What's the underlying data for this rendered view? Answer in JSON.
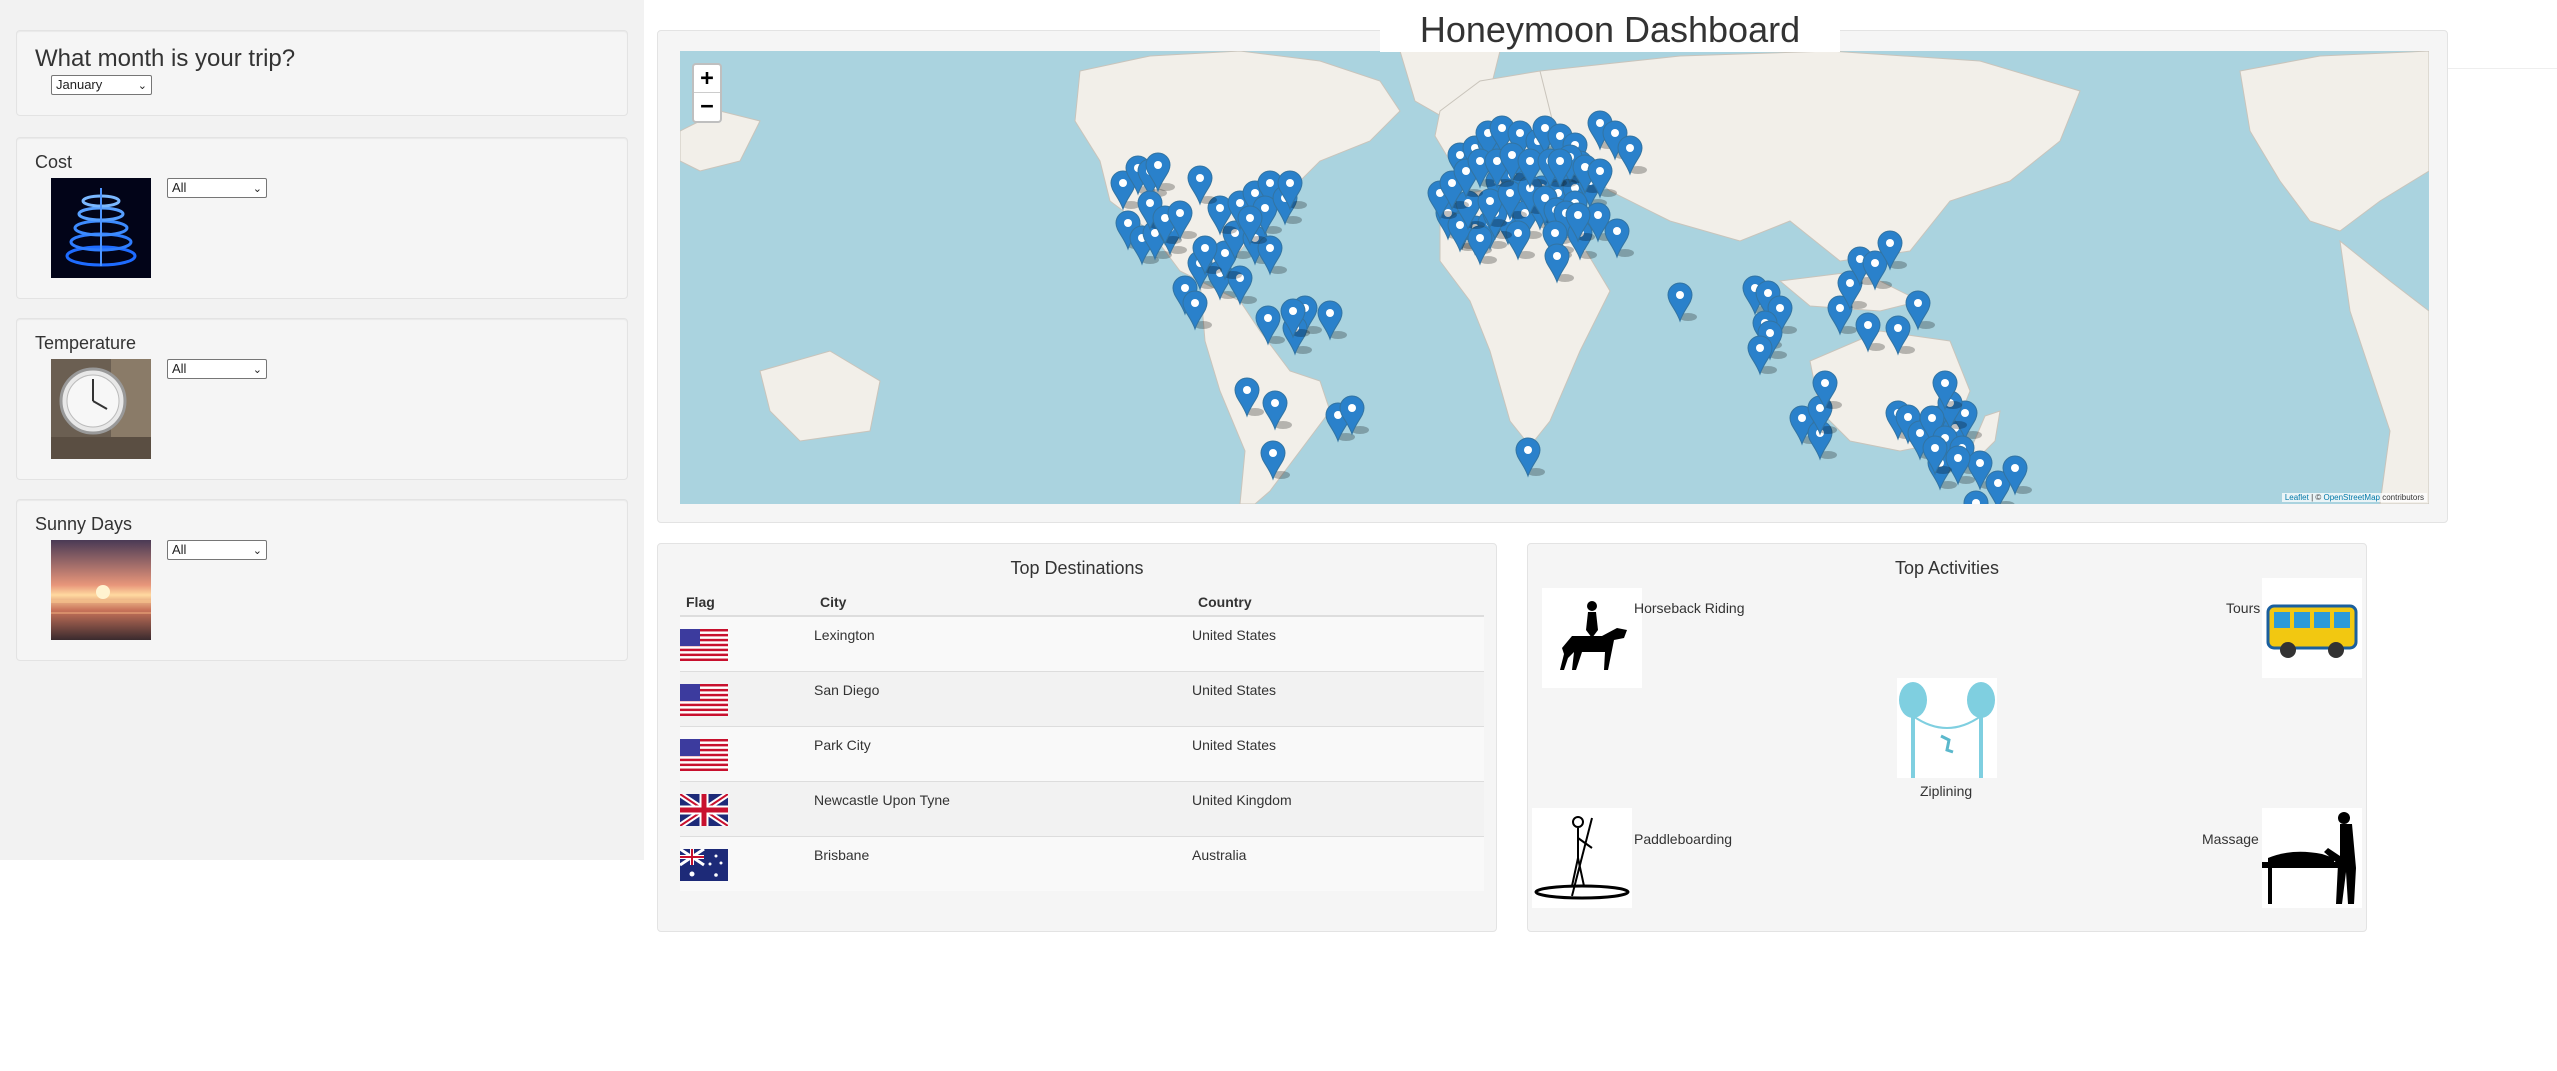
{
  "header": {
    "title": "Honeymoon Dashboard"
  },
  "sidebar": {
    "month": {
      "label": "What month is your trip?",
      "selected": "January"
    },
    "cost": {
      "label": "Cost",
      "selected": "All",
      "image": "cost-image"
    },
    "temperature": {
      "label": "Temperature",
      "selected": "All",
      "image": "thermometer-image"
    },
    "sunny": {
      "label": "Sunny Days",
      "selected": "All",
      "image": "sunset-image"
    }
  },
  "map": {
    "zoom_in": "+",
    "zoom_out": "−",
    "attribution_leaflet": "Leaflet",
    "attribution_sep": " | © ",
    "attribution_osm": "OpenStreetMap",
    "attribution_tail": " contributors",
    "marker_color": "#2a81cb"
  },
  "destinations": {
    "title": "Top Destinations",
    "columns": [
      "Flag",
      "City",
      "Country"
    ],
    "rows": [
      {
        "flag": "us-flag",
        "city": "Lexington",
        "country": "United States"
      },
      {
        "flag": "us-flag",
        "city": "San Diego",
        "country": "United States"
      },
      {
        "flag": "us-flag",
        "city": "Park City",
        "country": "United States"
      },
      {
        "flag": "uk-flag",
        "city": "Newcastle Upon Tyne",
        "country": "United Kingdom"
      },
      {
        "flag": "au-flag",
        "city": "Brisbane",
        "country": "Australia"
      }
    ]
  },
  "activities": {
    "title": "Top Activities",
    "items": [
      {
        "label": "Horseback Riding",
        "icon": "horse-rider-icon"
      },
      {
        "label": "Tours",
        "icon": "bus-icon"
      },
      {
        "label": "Ziplining",
        "icon": "zipline-icon"
      },
      {
        "label": "Paddleboarding",
        "icon": "paddleboard-icon"
      },
      {
        "label": "Massage",
        "icon": "massage-icon"
      }
    ]
  }
}
